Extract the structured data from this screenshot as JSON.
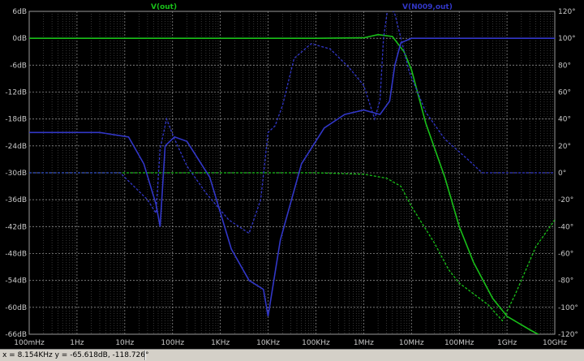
{
  "chart_data": {
    "type": "line",
    "x_scale": "log",
    "x_range": [
      "100mHz",
      "10GHz"
    ],
    "y_left_range_dB": [
      -66,
      120
    ],
    "y_left_visible_range_dB": [
      -66,
      12
    ],
    "y_right_range_deg": [
      -120,
      120
    ],
    "grid": true,
    "x_ticks": [
      "100mHz",
      "1Hz",
      "10Hz",
      "100Hz",
      "1KHz",
      "10KHz",
      "100KHz",
      "1MHz",
      "10MHz",
      "100MHz",
      "1GHz",
      "10GHz"
    ],
    "y_left_ticks": [
      "6dB",
      "0dB",
      "-6dB",
      "-12dB",
      "-18dB",
      "-24dB",
      "-30dB",
      "-36dB",
      "-42dB",
      "-48dB",
      "-54dB",
      "-60dB",
      "-66dB"
    ],
    "y_right_ticks": [
      "120°",
      "100°",
      "80°",
      "60°",
      "40°",
      "20°",
      "0°",
      "-20°",
      "-40°",
      "-60°",
      "-80°",
      "-100°",
      "-120°"
    ],
    "series": [
      {
        "name": "V(out)",
        "color": "#19c019",
        "magnitude_dB": [
          [
            0.1,
            0
          ],
          [
            1,
            0
          ],
          [
            10,
            0
          ],
          [
            100,
            0
          ],
          [
            1000,
            0
          ],
          [
            10000,
            0
          ],
          [
            100000,
            0
          ],
          [
            1000000,
            0.1
          ],
          [
            2000000,
            0.8
          ],
          [
            4000000,
            0.4
          ],
          [
            7000000,
            -3
          ],
          [
            10000000,
            -7
          ],
          [
            20000000,
            -19
          ],
          [
            50000000,
            -31
          ],
          [
            100000000,
            -42
          ],
          [
            200000000,
            -50
          ],
          [
            500000000,
            -58
          ],
          [
            1000000000,
            -62
          ],
          [
            3000000000,
            -65
          ],
          [
            10000000000,
            -68
          ]
        ],
        "phase_deg": [
          [
            0.1,
            0
          ],
          [
            10,
            0
          ],
          [
            1000,
            0
          ],
          [
            100000,
            0
          ],
          [
            1000000,
            -1
          ],
          [
            3000000,
            -4
          ],
          [
            6000000,
            -10
          ],
          [
            10000000,
            -25
          ],
          [
            30000000,
            -52
          ],
          [
            60000000,
            -72
          ],
          [
            100000000,
            -82
          ],
          [
            400000000,
            -98
          ],
          [
            800000000,
            -110
          ],
          [
            1500000000,
            -90
          ],
          [
            4000000000,
            -55
          ],
          [
            10000000000,
            -35
          ]
        ]
      },
      {
        "name": "V(N009,out)",
        "color": "#3237c8",
        "magnitude_dB": [
          [
            0.1,
            -21
          ],
          [
            3,
            -21
          ],
          [
            12,
            -22
          ],
          [
            25,
            -28
          ],
          [
            45,
            -37
          ],
          [
            55,
            -42
          ],
          [
            70,
            -24
          ],
          [
            110,
            -22
          ],
          [
            200,
            -23
          ],
          [
            600,
            -31
          ],
          [
            1700,
            -47
          ],
          [
            4000,
            -54
          ],
          [
            8000,
            -56
          ],
          [
            10000,
            -62
          ],
          [
            18000,
            -45
          ],
          [
            50000,
            -28
          ],
          [
            150000,
            -20
          ],
          [
            400000,
            -17
          ],
          [
            1000000,
            -16
          ],
          [
            2200000,
            -17
          ],
          [
            3500000,
            -14
          ],
          [
            4500000,
            -6
          ],
          [
            6000000,
            -1
          ],
          [
            10000000,
            0
          ],
          [
            100000000,
            0
          ],
          [
            10000000000,
            0
          ]
        ],
        "phase_deg": [
          [
            0.1,
            0
          ],
          [
            8,
            0
          ],
          [
            30,
            -20
          ],
          [
            45,
            -30
          ],
          [
            55,
            18
          ],
          [
            75,
            40
          ],
          [
            110,
            25
          ],
          [
            200,
            5
          ],
          [
            500,
            -15
          ],
          [
            1500,
            -35
          ],
          [
            4000,
            -45
          ],
          [
            7000,
            -20
          ],
          [
            10000,
            30
          ],
          [
            14000,
            35
          ],
          [
            20000,
            50
          ],
          [
            35000,
            85
          ],
          [
            80000,
            96
          ],
          [
            200000,
            92
          ],
          [
            500000,
            78
          ],
          [
            1000000,
            65
          ],
          [
            1700000,
            40
          ],
          [
            2200000,
            54
          ],
          [
            2600000,
            100
          ],
          [
            3300000,
            126
          ],
          [
            4500000,
            118
          ],
          [
            9000000,
            75
          ],
          [
            20000000,
            45
          ],
          [
            50000000,
            25
          ],
          [
            150000000,
            10
          ],
          [
            300000000,
            0
          ],
          [
            10000000000,
            0
          ]
        ]
      }
    ]
  },
  "status": {
    "cursor_readout": "x = 8.154KHz   y = -65.618dB, -118.726°"
  }
}
